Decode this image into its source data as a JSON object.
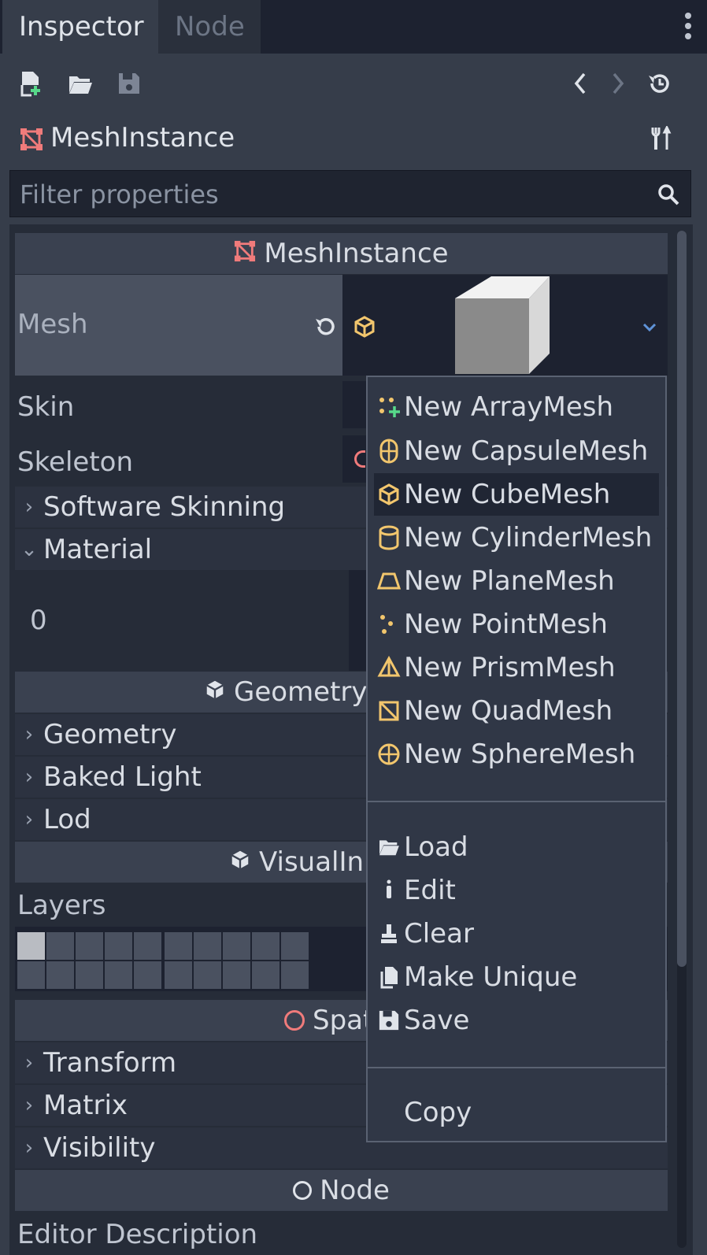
{
  "tabs": [
    "Inspector",
    "Node"
  ],
  "object_name": "MeshInstance",
  "filter": {
    "placeholder": "Filter properties"
  },
  "sections": {
    "meshinstance": "MeshInstance",
    "geometry": "Geometry",
    "visual": "VisualIn",
    "spatial": "Spat",
    "node": "Node"
  },
  "props": {
    "mesh": "Mesh",
    "skin": "Skin",
    "skeleton": "Skeleton",
    "material_index": "0",
    "layers": "Layers",
    "editor_description": "Editor Description"
  },
  "groups": {
    "software_skinning": "Software Skinning",
    "material": "Material",
    "geometry": "Geometry",
    "baked_light": "Baked Light",
    "lod": "Lod",
    "transform": "Transform",
    "matrix": "Matrix",
    "visibility": "Visibility"
  },
  "menu": {
    "new_items": [
      "New ArrayMesh",
      "New CapsuleMesh",
      "New CubeMesh",
      "New CylinderMesh",
      "New PlaneMesh",
      "New PointMesh",
      "New PrismMesh",
      "New QuadMesh",
      "New SphereMesh"
    ],
    "actions": [
      "Load",
      "Edit",
      "Clear",
      "Make Unique",
      "Save"
    ],
    "copy": "Copy"
  },
  "colors": {
    "accent_red": "#f07b7b",
    "resource_yellow": "#f2c66d",
    "add_green": "#57d98a"
  },
  "icons": [
    "new-script-icon",
    "open-folder-icon",
    "save-icon",
    "back-icon",
    "forward-icon",
    "history-icon",
    "tools-icon",
    "search-icon",
    "revert-icon",
    "cube-icon",
    "dropdown-chevron-icon"
  ]
}
